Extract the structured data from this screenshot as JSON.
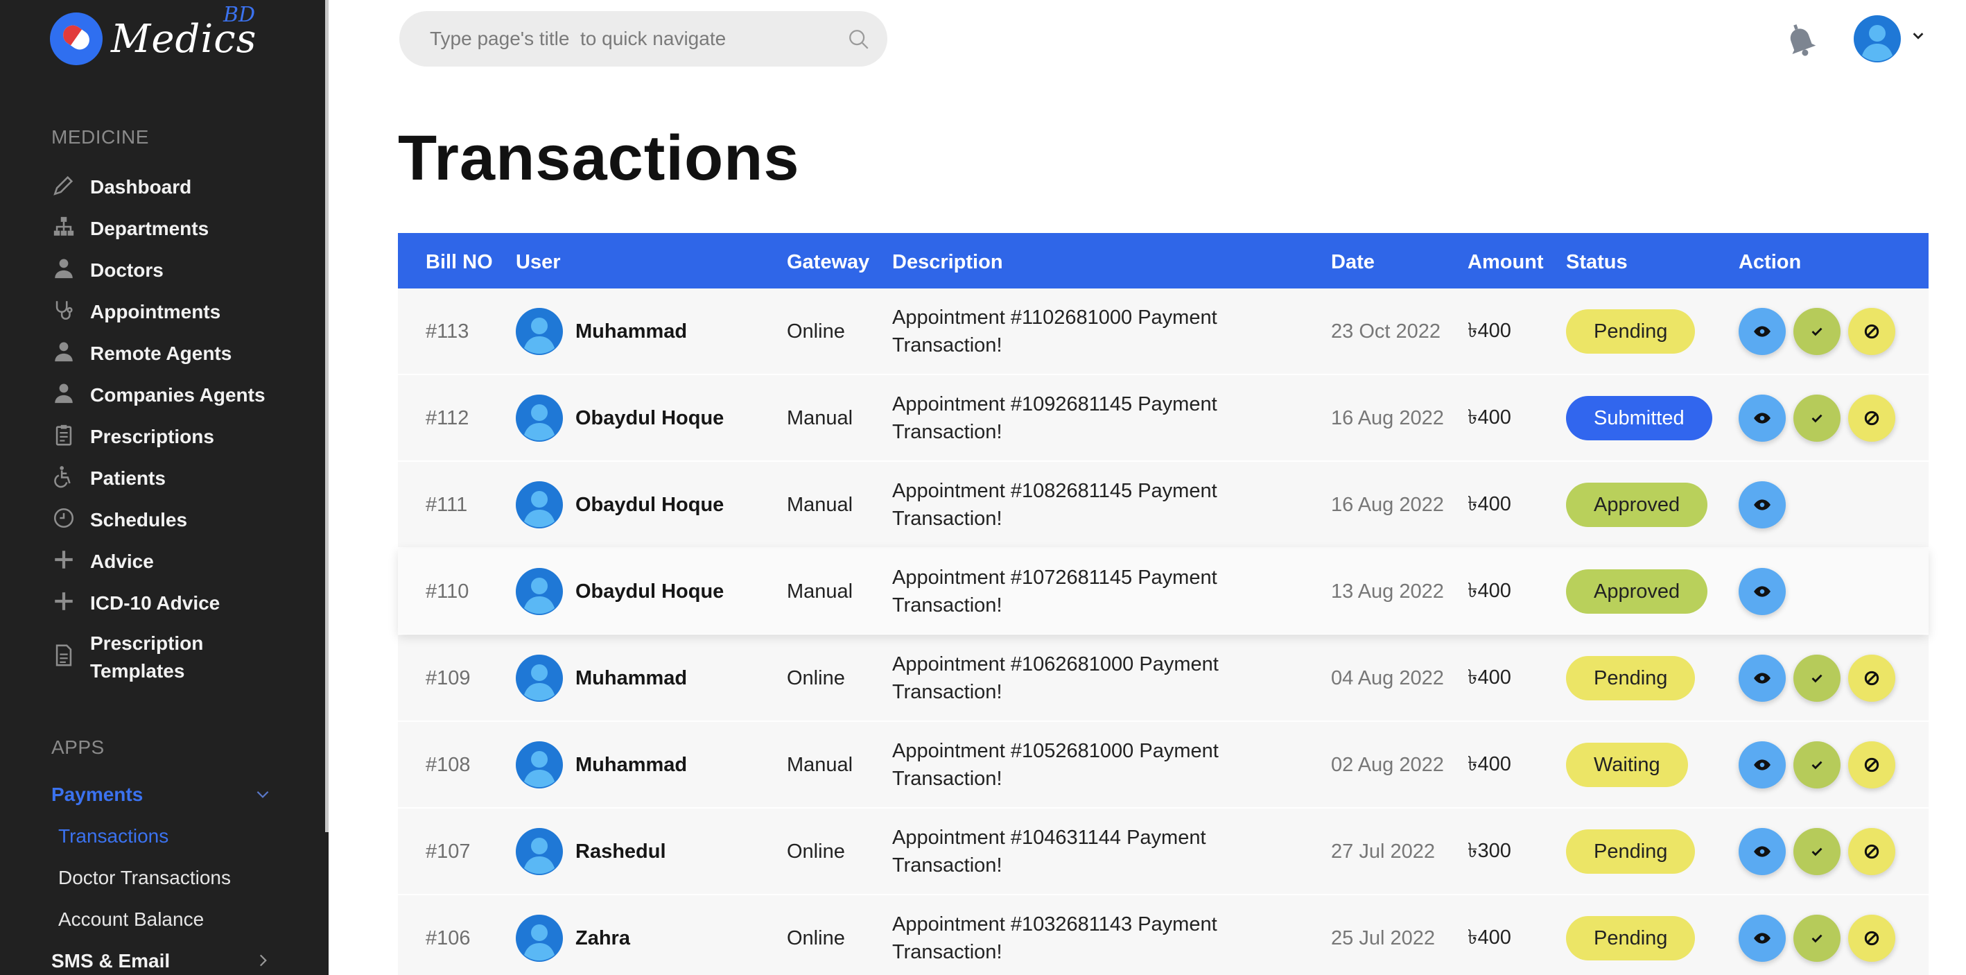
{
  "brand": {
    "name": "Medics",
    "sup": "BD"
  },
  "sidebar": {
    "section_medicine": "MEDICINE",
    "items": [
      {
        "label": "Dashboard",
        "icon": "pencil-icon"
      },
      {
        "label": "Departments",
        "icon": "hierarchy-icon"
      },
      {
        "label": "Doctors",
        "icon": "doctor-icon"
      },
      {
        "label": "Appointments",
        "icon": "stethoscope-icon"
      },
      {
        "label": "Remote Agents",
        "icon": "agent-icon"
      },
      {
        "label": "Companies Agents",
        "icon": "agent-icon"
      },
      {
        "label": "Prescriptions",
        "icon": "clipboard-icon"
      },
      {
        "label": "Patients",
        "icon": "wheelchair-icon"
      },
      {
        "label": "Schedules",
        "icon": "clock-icon"
      },
      {
        "label": "Advice",
        "icon": "plus-icon"
      },
      {
        "label": "ICD-10 Advice",
        "icon": "plus-icon"
      },
      {
        "label": "Prescription Templates",
        "label_line1": "Prescription",
        "label_line2": "Templates",
        "icon": "document-icon"
      }
    ],
    "section_apps": "APPS",
    "payments_label": "Payments",
    "payments_sub": [
      "Transactions",
      "Doctor Transactions",
      "Account Balance"
    ],
    "sms_label": "SMS & Email"
  },
  "topbar": {
    "search_placeholder": "Type page's title  to quick navigate"
  },
  "page_title": "Transactions",
  "table": {
    "headers": [
      "Bill NO",
      "User",
      "Gateway",
      "Description",
      "Date",
      "Amount",
      "Status",
      "Action"
    ],
    "rows": [
      {
        "bill": "#113",
        "user": "Muhammad",
        "gateway": "Online",
        "desc1": "Appointment #1102681000 Payment",
        "desc2": "Transaction!",
        "date": "23 Oct 2022",
        "amount": "৳400",
        "status": "Pending",
        "status_type": "pending",
        "actions": 3
      },
      {
        "bill": "#112",
        "user": "Obaydul Hoque",
        "gateway": "Manual",
        "desc1": "Appointment #1092681145 Payment",
        "desc2": "Transaction!",
        "date": "16 Aug 2022",
        "amount": "৳400",
        "status": "Submitted",
        "status_type": "submitted",
        "actions": 3
      },
      {
        "bill": "#111",
        "user": "Obaydul Hoque",
        "gateway": "Manual",
        "desc1": "Appointment #1082681145 Payment",
        "desc2": "Transaction!",
        "date": "16 Aug 2022",
        "amount": "৳400",
        "status": "Approved",
        "status_type": "approved",
        "actions": 1
      },
      {
        "bill": "#110",
        "user": "Obaydul Hoque",
        "gateway": "Manual",
        "desc1": "Appointment #1072681145 Payment",
        "desc2": "Transaction!",
        "date": "13 Aug 2022",
        "amount": "৳400",
        "status": "Approved",
        "status_type": "approved",
        "actions": 1
      },
      {
        "bill": "#109",
        "user": "Muhammad",
        "gateway": "Online",
        "desc1": "Appointment #1062681000 Payment",
        "desc2": "Transaction!",
        "date": "04 Aug 2022",
        "amount": "৳400",
        "status": "Pending",
        "status_type": "pending",
        "actions": 3
      },
      {
        "bill": "#108",
        "user": "Muhammad",
        "gateway": "Manual",
        "desc1": "Appointment #1052681000 Payment",
        "desc2": "Transaction!",
        "date": "02 Aug 2022",
        "amount": "৳400",
        "status": "Waiting",
        "status_type": "waiting",
        "actions": 3
      },
      {
        "bill": "#107",
        "user": "Rashedul",
        "gateway": "Online",
        "desc1": "Appointment #104631144 Payment",
        "desc2": "Transaction!",
        "date": "27 Jul 2022",
        "amount": "৳300",
        "status": "Pending",
        "status_type": "pending",
        "actions": 3
      },
      {
        "bill": "#106",
        "user": "Zahra",
        "gateway": "Online",
        "desc1": "Appointment #1032681143 Payment",
        "desc2": "Transaction!",
        "date": "25 Jul 2022",
        "amount": "৳400",
        "status": "Pending",
        "status_type": "pending",
        "actions": 3
      }
    ]
  },
  "colors": {
    "accent": "#2f66e8",
    "sidebar_bg": "#212121",
    "pending": "#ece566",
    "approved": "#b9d05b",
    "submitted": "#3166ee",
    "view_button": "#5aaaf2"
  }
}
